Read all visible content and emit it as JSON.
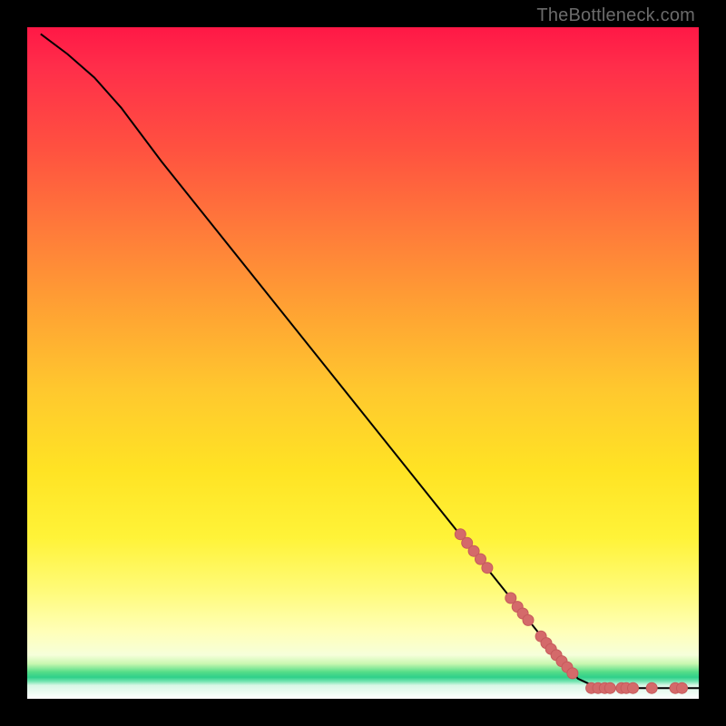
{
  "watermark": "TheBottleneck.com",
  "colors": {
    "dot_fill": "#d46a6a",
    "dot_stroke": "#c65a5c",
    "line": "#000000"
  },
  "chart_data": {
    "type": "line",
    "title": "",
    "xlabel": "",
    "ylabel": "",
    "xlim": [
      0,
      100
    ],
    "ylim": [
      0,
      100
    ],
    "grid": false,
    "line_points": [
      {
        "x": 2,
        "y": 99
      },
      {
        "x": 6,
        "y": 96
      },
      {
        "x": 10,
        "y": 92.5
      },
      {
        "x": 14,
        "y": 88
      },
      {
        "x": 20,
        "y": 80
      },
      {
        "x": 28,
        "y": 70
      },
      {
        "x": 36,
        "y": 60
      },
      {
        "x": 44,
        "y": 50
      },
      {
        "x": 52,
        "y": 40
      },
      {
        "x": 60,
        "y": 30
      },
      {
        "x": 68,
        "y": 20
      },
      {
        "x": 76,
        "y": 10
      },
      {
        "x": 82,
        "y": 3
      },
      {
        "x": 85,
        "y": 1.6
      },
      {
        "x": 100,
        "y": 1.6
      }
    ],
    "highlight_dots": [
      {
        "x": 64.5,
        "y": 24.5
      },
      {
        "x": 65.5,
        "y": 23.2
      },
      {
        "x": 66.5,
        "y": 22.0
      },
      {
        "x": 67.5,
        "y": 20.8
      },
      {
        "x": 68.5,
        "y": 19.5
      },
      {
        "x": 72.0,
        "y": 15.0
      },
      {
        "x": 73.0,
        "y": 13.7
      },
      {
        "x": 73.8,
        "y": 12.7
      },
      {
        "x": 74.6,
        "y": 11.7
      },
      {
        "x": 76.5,
        "y": 9.3
      },
      {
        "x": 77.3,
        "y": 8.3
      },
      {
        "x": 78.0,
        "y": 7.4
      },
      {
        "x": 78.8,
        "y": 6.5
      },
      {
        "x": 79.6,
        "y": 5.6
      },
      {
        "x": 80.4,
        "y": 4.7
      },
      {
        "x": 81.2,
        "y": 3.8
      },
      {
        "x": 84.0,
        "y": 1.6
      },
      {
        "x": 85.0,
        "y": 1.6
      },
      {
        "x": 86.0,
        "y": 1.6
      },
      {
        "x": 86.8,
        "y": 1.6
      },
      {
        "x": 88.5,
        "y": 1.6
      },
      {
        "x": 89.2,
        "y": 1.6
      },
      {
        "x": 90.2,
        "y": 1.6
      },
      {
        "x": 93.0,
        "y": 1.6
      },
      {
        "x": 96.5,
        "y": 1.6
      },
      {
        "x": 97.5,
        "y": 1.6
      }
    ],
    "dot_radius": 6
  }
}
